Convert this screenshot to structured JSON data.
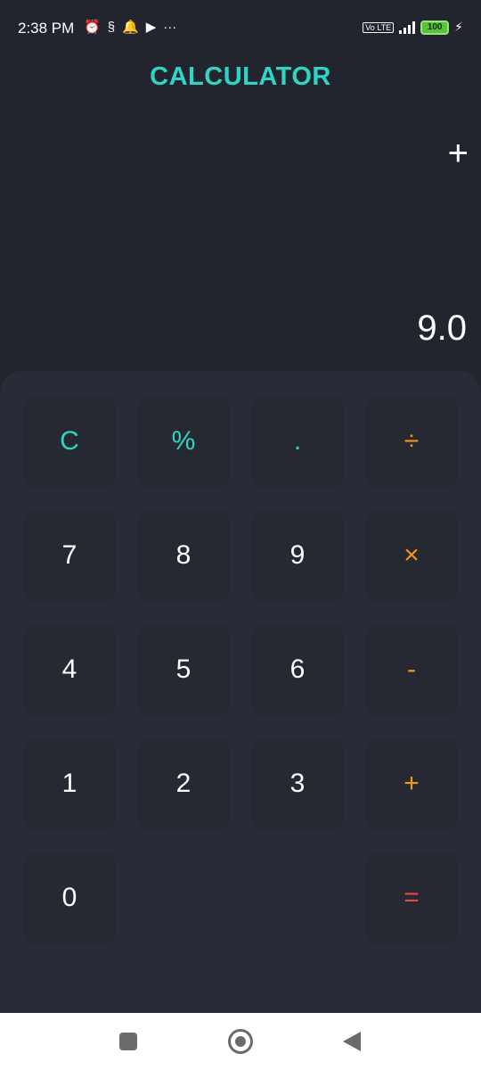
{
  "status_bar": {
    "time": "2:38 PM",
    "left_icons": [
      "alarm-icon",
      "data-saver-icon",
      "notification-bell-icon",
      "play-icon",
      "more-icon"
    ],
    "network_badge": "Vo LTE",
    "battery": "100",
    "charging": true
  },
  "app": {
    "title": "CALCULATOR"
  },
  "display": {
    "operator": "+",
    "result": "9.0"
  },
  "keys": {
    "clear": "C",
    "percent": "%",
    "dot": ".",
    "divide": "÷",
    "seven": "7",
    "eight": "8",
    "nine": "9",
    "multiply": "×",
    "four": "4",
    "five": "5",
    "six": "6",
    "minus": "-",
    "one": "1",
    "two": "2",
    "three": "3",
    "plus": "+",
    "zero": "0",
    "equals": "="
  },
  "colors": {
    "background": "#22252d",
    "keypad": "#292c36",
    "key": "#262931",
    "accent_teal": "#2fd5c4",
    "accent_orange": "#f1961d",
    "accent_red": "#e84545"
  },
  "nav_bar": {
    "buttons": [
      "recents-icon",
      "home-icon",
      "back-icon"
    ]
  }
}
